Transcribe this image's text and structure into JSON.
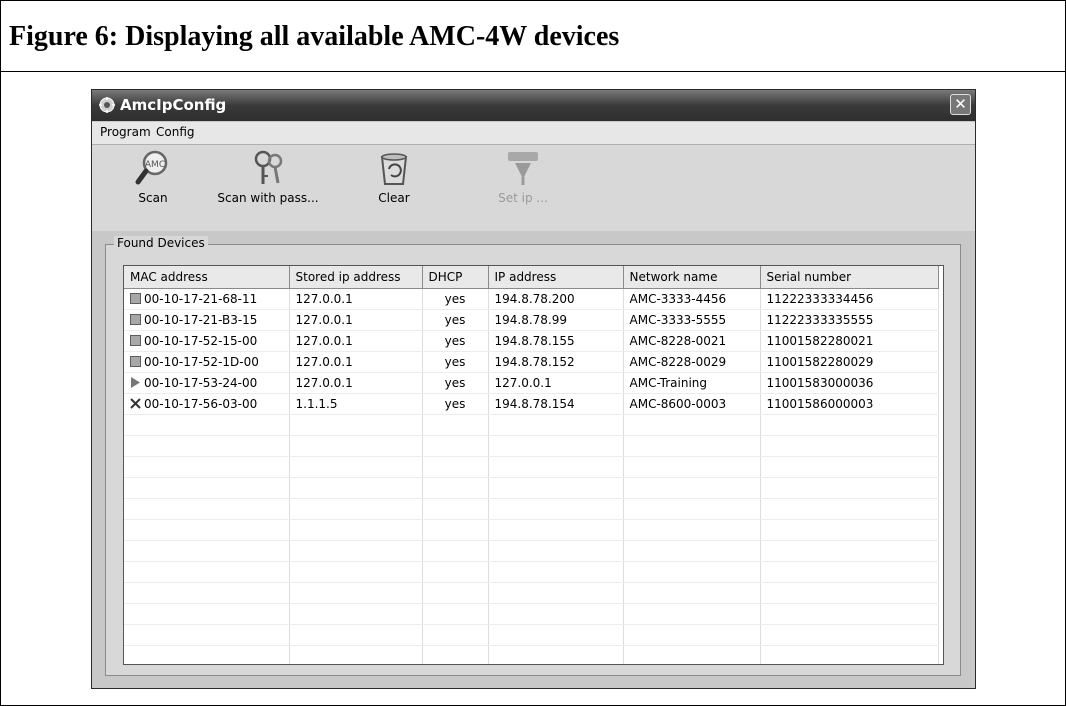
{
  "figure_title": "Figure 6: Displaying all available AMC-4W devices",
  "window": {
    "title": "AmcIpConfig",
    "close_glyph": "✕"
  },
  "menu": {
    "items": [
      "Program",
      "Config"
    ]
  },
  "toolbar": {
    "scan": {
      "label": "Scan",
      "icon": "magnifier-icon",
      "icon_text": "AMC"
    },
    "scan_with_pass": {
      "label": "Scan with pass...",
      "icon": "keys-icon"
    },
    "clear": {
      "label": "Clear",
      "icon": "recycle-bin-icon"
    },
    "set_ip": {
      "label": "Set ip ...",
      "icon": "set-ip-icon",
      "disabled": true
    }
  },
  "found_devices": {
    "label": "Found Devices",
    "columns": [
      "MAC address",
      "Stored ip address",
      "DHCP",
      "IP address",
      "Network name",
      "Serial number"
    ],
    "rows": [
      {
        "status": "square",
        "mac": "00-10-17-21-68-11",
        "stored_ip": "127.0.0.1",
        "dhcp": "yes",
        "ip": "194.8.78.200",
        "network_name": "AMC-3333-4456",
        "serial": "11222333334456"
      },
      {
        "status": "square",
        "mac": "00-10-17-21-B3-15",
        "stored_ip": "127.0.0.1",
        "dhcp": "yes",
        "ip": "194.8.78.99",
        "network_name": "AMC-3333-5555",
        "serial": "11222333335555"
      },
      {
        "status": "square",
        "mac": "00-10-17-52-15-00",
        "stored_ip": "127.0.0.1",
        "dhcp": "yes",
        "ip": "194.8.78.155",
        "network_name": "AMC-8228-0021",
        "serial": "11001582280021"
      },
      {
        "status": "square",
        "mac": "00-10-17-52-1D-00",
        "stored_ip": "127.0.0.1",
        "dhcp": "yes",
        "ip": "194.8.78.152",
        "network_name": "AMC-8228-0029",
        "serial": "11001582280029"
      },
      {
        "status": "arrow",
        "mac": "00-10-17-53-24-00",
        "stored_ip": "127.0.0.1",
        "dhcp": "yes",
        "ip": "127.0.0.1",
        "network_name": "AMC-Training",
        "serial": "11001583000036"
      },
      {
        "status": "cross",
        "mac": "00-10-17-56-03-00",
        "stored_ip": "1.1.1.5",
        "dhcp": "yes",
        "ip": "194.8.78.154",
        "network_name": "AMC-8600-0003",
        "serial": "11001586000003"
      }
    ]
  }
}
